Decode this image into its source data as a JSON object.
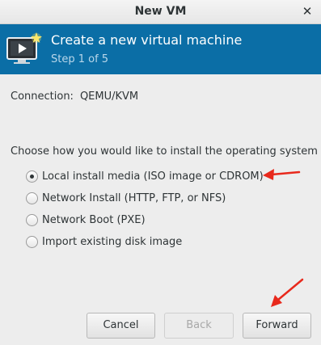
{
  "window": {
    "title": "New VM",
    "close_icon": "close-icon"
  },
  "banner": {
    "heading": "Create a new virtual machine",
    "step": "Step 1 of 5",
    "icon": "virtual-machine-icon",
    "background_color": "#0b6ea6"
  },
  "connection": {
    "label": "Connection:",
    "value": "QEMU/KVM"
  },
  "install": {
    "question": "Choose how you would like to install the operating system",
    "options": [
      {
        "label": "Local install media (ISO image or CDROM)",
        "selected": true
      },
      {
        "label": "Network Install (HTTP, FTP, or NFS)",
        "selected": false
      },
      {
        "label": "Network Boot (PXE)",
        "selected": false
      },
      {
        "label": "Import existing disk image",
        "selected": false
      }
    ]
  },
  "buttons": {
    "cancel": "Cancel",
    "back": "Back",
    "forward": "Forward"
  },
  "annotations": {
    "arrow_color": "#e8291c"
  }
}
